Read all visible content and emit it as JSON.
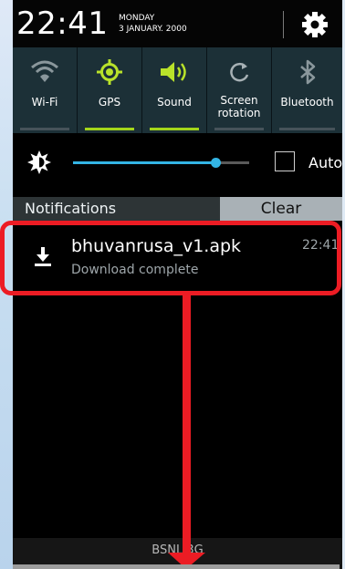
{
  "status_bar": {
    "time": "22:41",
    "day": "MONDAY",
    "date": "3 JANUARY. 2000",
    "settings_icon": "gear-icon"
  },
  "quick_settings": [
    {
      "label": "Wi-Fi",
      "icon": "wifi-icon",
      "on": false
    },
    {
      "label": "GPS",
      "icon": "gps-icon",
      "on": true
    },
    {
      "label": "Sound",
      "icon": "speaker-icon",
      "on": true
    },
    {
      "label": "Screen\nrotation",
      "icon": "rotation-icon",
      "on": false
    },
    {
      "label": "Bluetooth",
      "icon": "bluetooth-icon",
      "on": false
    }
  ],
  "brightness": {
    "icon": "brightness-icon",
    "level": 0.81,
    "auto_label": "Auto",
    "auto_checked": false
  },
  "notifications": {
    "header": "Notifications",
    "clear_label": "Clear",
    "items": [
      {
        "icon": "download-icon",
        "title": "bhuvanrusa_v1.apk",
        "subtitle": "Download complete",
        "time": "22:41"
      }
    ]
  },
  "carrier": "BSNL 3G",
  "colors": {
    "accent_active": "#a4d51a",
    "slider": "#33b5e5",
    "annotation": "#ec1c24"
  }
}
